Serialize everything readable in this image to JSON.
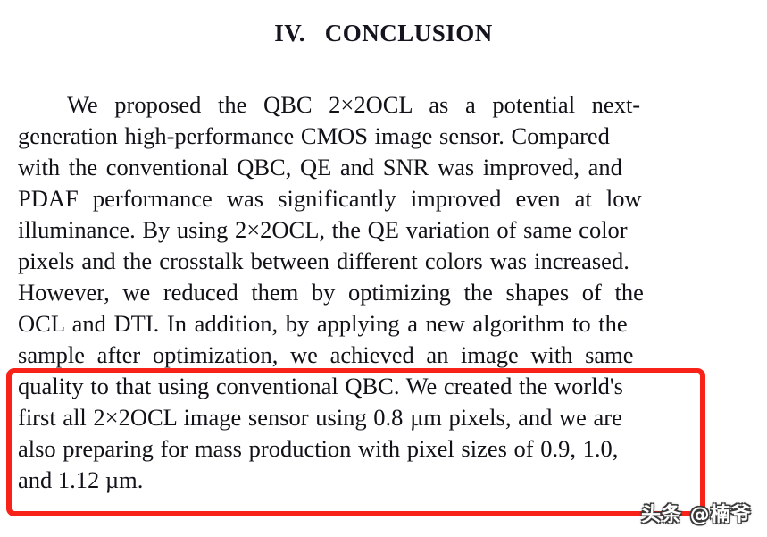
{
  "document": {
    "heading": "IV.   CONCLUSION",
    "paragraph_lines": [
      "We  proposed  the  QBC  2×2OCL  as  a  potential  next-",
      "generation high-performance CMOS image sensor. Compared",
      "with the conventional QBC, QE and SNR was improved, and",
      "PDAF  performance  was  significantly  improved  even  at  low",
      "illuminance. By using 2×2OCL, the QE variation of same color",
      "pixels and the crosstalk between different colors was increased.",
      "However,  we  reduced  them  by  optimizing  the  shapes  of  the",
      "OCL and DTI. In addition, by applying a new algorithm to the",
      "sample  after  optimization,  we  achieved  an  image  with  same",
      "quality to that using conventional QBC. We created the world's",
      "first all 2×2OCL image sensor using 0.8 µm pixels, and we are",
      "also preparing for mass production with pixel sizes of 0.9, 1.0,",
      "and 1.12 µm."
    ],
    "full_paragraph": "We proposed the QBC 2×2OCL as a potential next-generation high-performance CMOS image sensor. Compared with the conventional QBC, QE and SNR was improved, and PDAF performance was significantly improved even at low illuminance. By using 2×2OCL, the QE variation of same color pixels and the crosstalk between different colors was increased. However, we reduced them by optimizing the shapes of the OCL and DTI. In addition, by applying a new algorithm to the sample after optimization, we achieved an image with same quality to that using conventional QBC. We created the world's first all 2×2OCL image sensor using 0.8 µm pixels, and we are also preparing for mass production with pixel sizes of 0.9, 1.0, and 1.12 µm."
  },
  "annotation": {
    "highlight_color": "#f92218",
    "highlighted_lines": [
      "quality to that using conventional QBC. We created the world's",
      "first all 2×2OCL image sensor using 0.8 µm pixels, and we are",
      "also preparing for mass production with pixel sizes of 0.9, 1.0,",
      "and 1.12 µm."
    ]
  },
  "watermark": {
    "text": "头条 @楠爷"
  },
  "colors": {
    "text": "#111118",
    "background": "#ffffff",
    "highlight": "#f92218",
    "watermark_fill": "#ffffff"
  }
}
